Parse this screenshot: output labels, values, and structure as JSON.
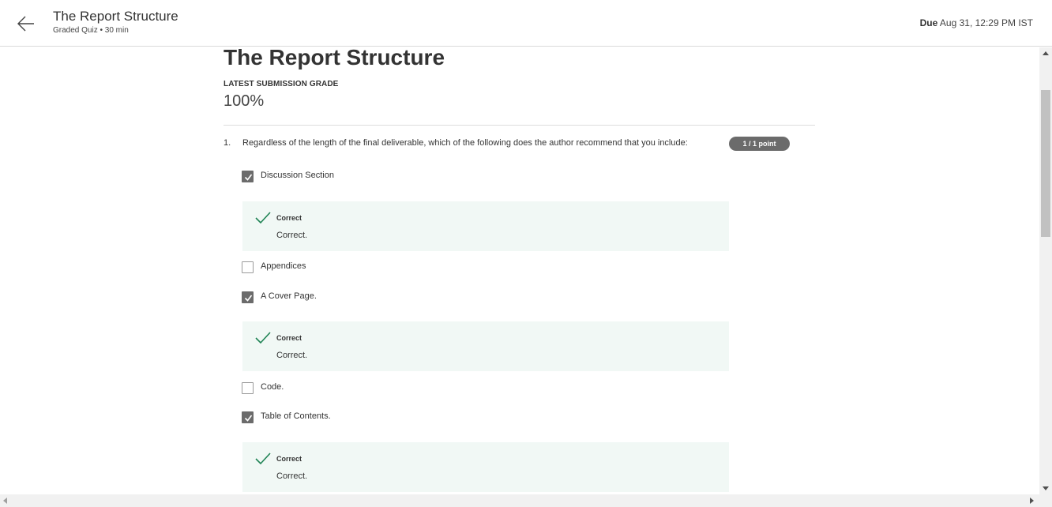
{
  "header": {
    "title": "The Report Structure",
    "subtitle": "Graded Quiz • 30 min",
    "due_label": "Due",
    "due_value": "Aug 31, 12:29 PM IST"
  },
  "main": {
    "title": "The Report Structure",
    "grade_label": "LATEST SUBMISSION GRADE",
    "grade_value": "100%",
    "question": {
      "number": "1.",
      "text": "Regardless of the length of the final deliverable, which of the following does the author recommend that you include:",
      "points": "1 / 1 point",
      "options": [
        {
          "label": "Discussion Section",
          "checked": true
        },
        {
          "label": "Appendices",
          "checked": false
        },
        {
          "label": "A Cover Page.",
          "checked": true
        },
        {
          "label": "Code.",
          "checked": false
        },
        {
          "label": "Table of Contents.",
          "checked": true
        }
      ],
      "feedback": [
        {
          "title": "Correct",
          "text": "Correct."
        },
        {
          "title": "Correct",
          "text": "Correct."
        },
        {
          "title": "Correct",
          "text": "Correct."
        }
      ]
    }
  },
  "colors": {
    "correct_green": "#1f8354",
    "feedback_bg": "#f1f8f5",
    "badge_bg": "#6b6b6b"
  }
}
